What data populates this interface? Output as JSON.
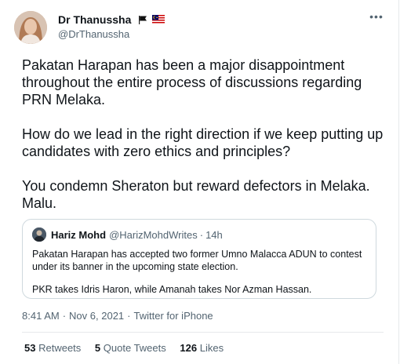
{
  "author": {
    "display_name": "Dr Thanussha",
    "handle": "@DrThanussha",
    "flag_icons": [
      "black-flag-icon",
      "malaysia-flag-icon"
    ]
  },
  "tweet": {
    "paragraphs": [
      "Pakatan Harapan has been a major disappointment throughout the entire process of discussions regarding PRN Melaka.",
      "How do we lead in the right direction if we keep putting up candidates with zero ethics and principles?",
      "You condemn Sheraton but reward defectors in Melaka. Malu."
    ]
  },
  "quote": {
    "name": "Hariz Mohd",
    "handle": "@HarizMohdWrites",
    "separator": "·",
    "time": "14h",
    "paragraphs": [
      "Pakatan Harapan has accepted two former Umno Malacca ADUN to contest under its banner in the upcoming state election.",
      "PKR takes Idris Haron, while Amanah takes Nor Azman Hassan."
    ]
  },
  "meta": {
    "time": "8:41 AM",
    "separator": "·",
    "date": "Nov 6, 2021",
    "source": "Twitter for iPhone"
  },
  "stats": {
    "retweets": {
      "count": "53",
      "label": "Retweets"
    },
    "quotes": {
      "count": "5",
      "label": "Quote Tweets"
    },
    "likes": {
      "count": "126",
      "label": "Likes"
    }
  },
  "colors": {
    "text_primary": "#0f1419",
    "text_secondary": "#536471",
    "border": "#cfd9de"
  }
}
